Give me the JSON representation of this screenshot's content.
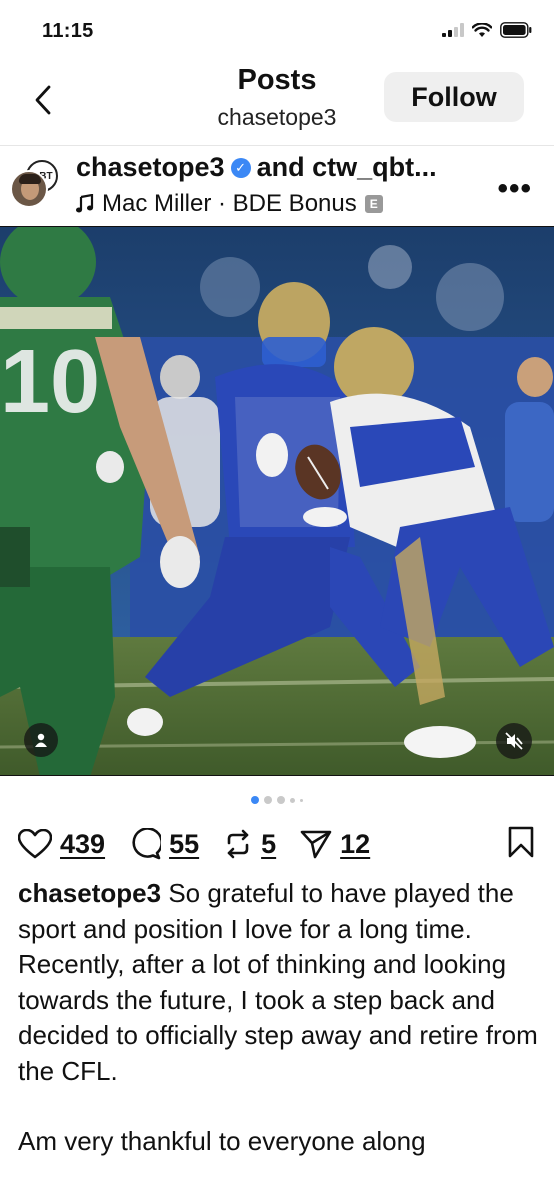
{
  "status_bar": {
    "time": "11:15",
    "icons": [
      "signal-icon",
      "wifi-icon",
      "battery-icon"
    ]
  },
  "nav": {
    "title": "Posts",
    "subtitle": "chasetope3",
    "follow_label": "Follow"
  },
  "post": {
    "authors_line": "chasetope3",
    "coauthor_text": "and ctw_qbt...",
    "audio": "Mac Miller · BDE Bonus",
    "explicit_badge": "E",
    "avatar_secondary_text": "QBT"
  },
  "carousel": {
    "total_dots": 5,
    "active_index": 0
  },
  "actions": {
    "likes": "439",
    "comments": "55",
    "reposts": "5",
    "shares": "12"
  },
  "caption": {
    "username": "chasetope3",
    "paragraph1": "So grateful to have played the sport and position I love for a long time. Recently, after a lot of thinking and looking towards the future, I took a step back and decided to officially step away and retire from the CFL.",
    "paragraph2": "Am very thankful to everyone along"
  },
  "colors": {
    "accent_blue": "#3b88f5",
    "follow_bg": "#efefef",
    "blue_jersey": "#2a48b8",
    "green_jersey": "#2f7a44"
  }
}
